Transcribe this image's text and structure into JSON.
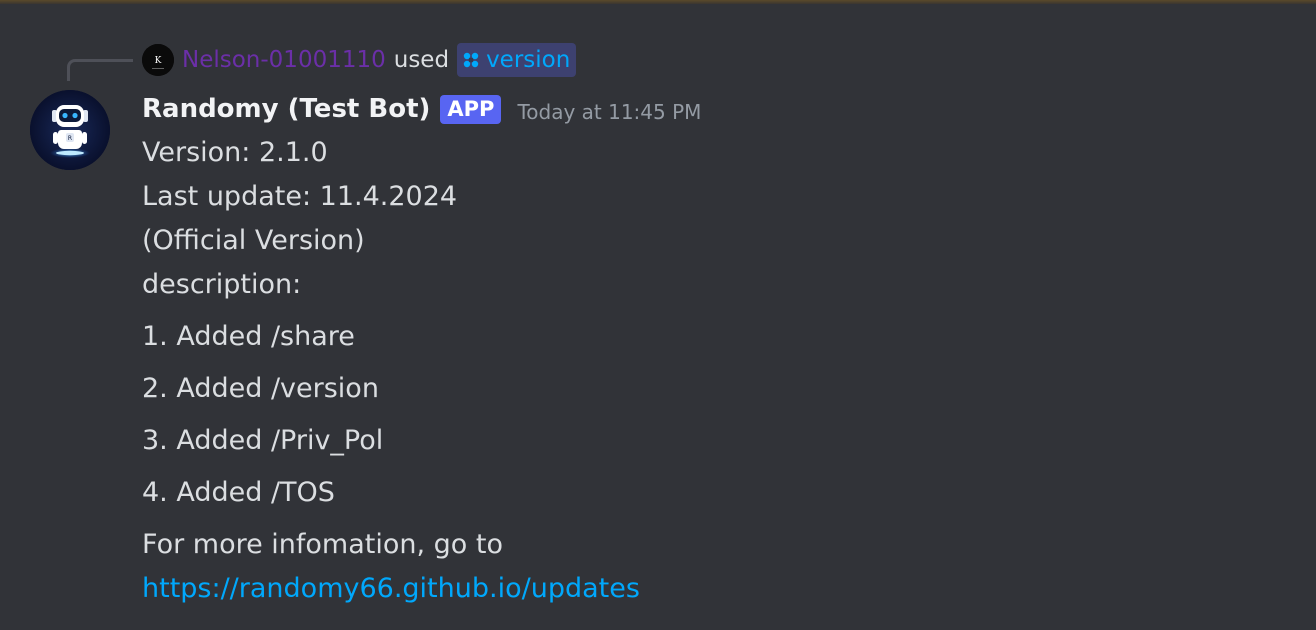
{
  "reply": {
    "user_name": "Nelson-01001110",
    "used_text": "used",
    "command_name": "version",
    "avatar_letter": "K"
  },
  "message": {
    "author": "Randomy (Test Bot)",
    "badge": "APP",
    "timestamp": "Today at 11:45 PM",
    "lines": [
      "Version: 2.1.0",
      "Last update: 11.4.2024",
      "(Official Version)",
      "description:"
    ],
    "list_items": [
      "1. Added /share",
      "2. Added /version",
      "3. Added /Priv_Pol",
      "4. Added /TOS"
    ],
    "footer_text": "For more infomation, go to",
    "link_text": "https://randomy66.github.io/updates"
  },
  "colors": {
    "background": "#313338",
    "reply_user": "#6b2fa8",
    "link": "#00a8fc",
    "app_badge": "#5865f2",
    "timestamp": "#949ba4"
  },
  "icons": {
    "command_icon": "slash-command-icon",
    "avatar": "robot-avatar"
  }
}
